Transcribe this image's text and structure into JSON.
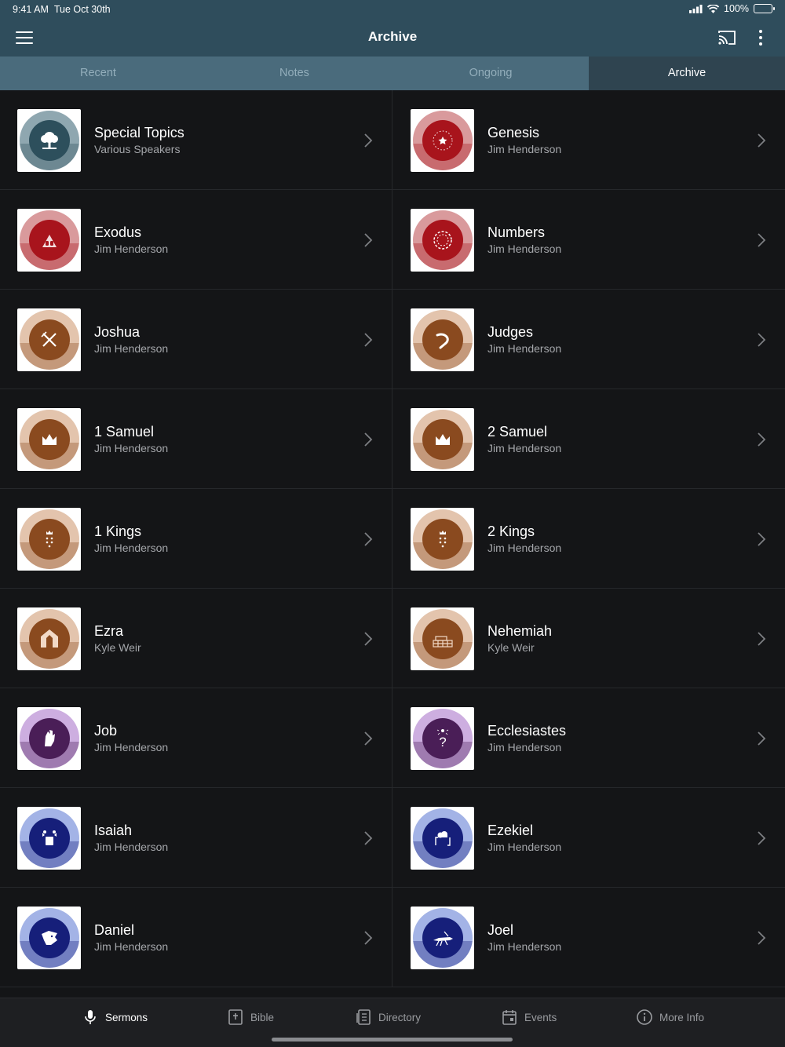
{
  "status_bar": {
    "time": "9:41 AM",
    "date": "Tue Oct 30th",
    "battery": "100%"
  },
  "header": {
    "title": "Archive"
  },
  "tabs": [
    {
      "label": "Recent"
    },
    {
      "label": "Notes"
    },
    {
      "label": "Ongoing"
    },
    {
      "label": "Archive",
      "active": true
    }
  ],
  "series": [
    {
      "title": "Special Topics",
      "speaker": "Various Speakers",
      "icon": "tree-icon",
      "color": "#2d4f5c",
      "ring": "#8fa7b0"
    },
    {
      "title": "Genesis",
      "speaker": "Jim Henderson",
      "icon": "star-icon",
      "color": "#a8141c",
      "ring": "#d99a9c"
    },
    {
      "title": "Exodus",
      "speaker": "Jim Henderson",
      "icon": "tablets-icon",
      "color": "#a8141c",
      "ring": "#d99a9c"
    },
    {
      "title": "Numbers",
      "speaker": "Jim Henderson",
      "icon": "circle-camp-icon",
      "color": "#a8141c",
      "ring": "#d99a9c"
    },
    {
      "title": "Joshua",
      "speaker": "Jim Henderson",
      "icon": "swords-icon",
      "color": "#8a4a1f",
      "ring": "#e3c4ad"
    },
    {
      "title": "Judges",
      "speaker": "Jim Henderson",
      "icon": "horn-icon",
      "color": "#8a4a1f",
      "ring": "#e3c4ad"
    },
    {
      "title": "1 Samuel",
      "speaker": "Jim Henderson",
      "icon": "crown-icon",
      "color": "#8a4a1f",
      "ring": "#e3c4ad"
    },
    {
      "title": "2 Samuel",
      "speaker": "Jim Henderson",
      "icon": "crown-icon",
      "color": "#8a4a1f",
      "ring": "#e3c4ad"
    },
    {
      "title": "1 Kings",
      "speaker": "Jim Henderson",
      "icon": "kings-icon",
      "color": "#8a4a1f",
      "ring": "#e3c4ad"
    },
    {
      "title": "2 Kings",
      "speaker": "Jim Henderson",
      "icon": "kings-icon",
      "color": "#8a4a1f",
      "ring": "#e3c4ad"
    },
    {
      "title": "Ezra",
      "speaker": "Kyle Weir",
      "icon": "temple-icon",
      "color": "#8a4a1f",
      "ring": "#e3c4ad"
    },
    {
      "title": "Nehemiah",
      "speaker": "Kyle Weir",
      "icon": "wall-icon",
      "color": "#8a4a1f",
      "ring": "#e3c4ad"
    },
    {
      "title": "Job",
      "speaker": "Jim Henderson",
      "icon": "hand-icon",
      "color": "#4a1e57",
      "ring": "#cdaee0"
    },
    {
      "title": "Ecclesiastes",
      "speaker": "Jim Henderson",
      "icon": "question-icon",
      "color": "#4a1e57",
      "ring": "#cdaee0"
    },
    {
      "title": "Isaiah",
      "speaker": "Jim Henderson",
      "icon": "throne-icon",
      "color": "#161f7a",
      "ring": "#a3b3e6"
    },
    {
      "title": "Ezekiel",
      "speaker": "Jim Henderson",
      "icon": "cloud-icon",
      "color": "#161f7a",
      "ring": "#a3b3e6"
    },
    {
      "title": "Daniel",
      "speaker": "Jim Henderson",
      "icon": "lion-icon",
      "color": "#161f7a",
      "ring": "#a3b3e6"
    },
    {
      "title": "Joel",
      "speaker": "Jim Henderson",
      "icon": "locust-icon",
      "color": "#161f7a",
      "ring": "#a3b3e6"
    }
  ],
  "bottom_nav": [
    {
      "label": "Sermons",
      "icon": "microphone-icon",
      "active": true
    },
    {
      "label": "Bible",
      "icon": "bible-icon"
    },
    {
      "label": "Directory",
      "icon": "directory-icon"
    },
    {
      "label": "Events",
      "icon": "calendar-icon"
    },
    {
      "label": "More Info",
      "icon": "info-icon"
    }
  ]
}
